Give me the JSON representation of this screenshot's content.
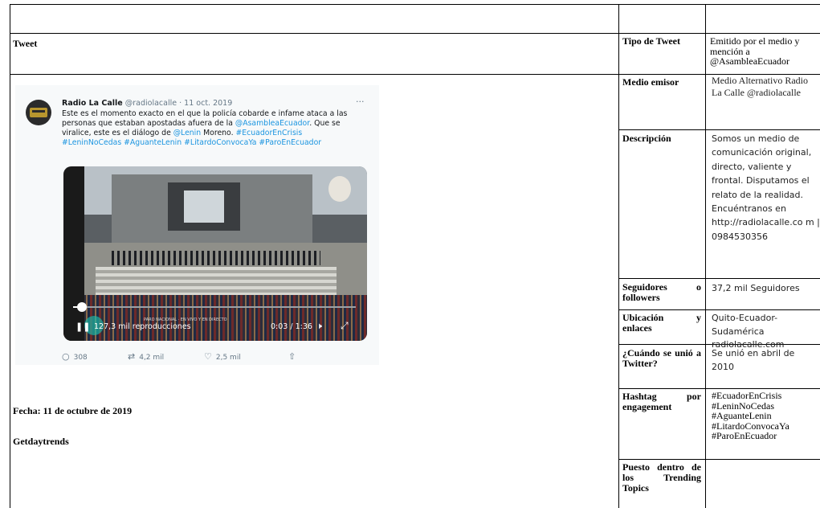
{
  "left_column": {
    "header": "Tweet",
    "fecha": "Fecha: 11 de octubre de 2019",
    "source": "Getdaytrends"
  },
  "tweet": {
    "name": "Radio La Calle",
    "handle": "@radiolacalle",
    "date": "· 11 oct. 2019",
    "more": "···",
    "text_1": "Este es el momento exacto en el que la policía cobarde e infame ataca a las personas que estaban apostadas afuera de la ",
    "mention_1": "@AsambleaEcuador",
    "text_2": ". Que se viralice, este es el diálogo de ",
    "mention_2": "@Lenin",
    "text_3": " Moreno. ",
    "hashtags_line1": "#EcuadorEnCrisis",
    "hashtags_line2": "#LeninNoCedas #AguanteLenin #LitardoConvocaYa #ParoEnEcuador",
    "video": {
      "views": "127,3 mil reproducciones",
      "overlay": "PARO NACIONAL · EN VIVO Y EN DIRECTO",
      "time": "0:03 / 1:36",
      "progress": 0.03
    },
    "actions": {
      "replies": "308",
      "retweets": "4,2 mil",
      "likes": "2,5 mil"
    }
  },
  "rows": [
    {
      "label": "Tipo de Tweet",
      "value": "Emitido por el medio y mención a @AsambleaEcuador"
    },
    {
      "label": "Medio emisor",
      "value": "Medio Alternativo Radio La Calle @radiolacalle"
    },
    {
      "label": "Descripción",
      "value": "Somos un medio de comunicación original, directo, valiente y frontal. Disputamos el relato de la realidad. Encuéntranos en http://radiolacalle.co m | 0984530356"
    },
    {
      "label": "Seguidores o followers",
      "value": "37,2 mil Seguidores"
    },
    {
      "label": "Ubicación y enlaces",
      "value": "Quito-Ecuador-Sudamérica radiolacalle.com"
    },
    {
      "label": "¿Cuándo se unió a Twitter?",
      "value": "Se unió en abril de 2010"
    },
    {
      "label": "Hashtag por engagement",
      "value": "#EcuadorEnCrisis #LeninNoCedas #AguanteLenin #LitardoConvocaYa #ParoEnEcuador"
    },
    {
      "label": "Puesto dentro de los Trending Topics",
      "value": ""
    }
  ]
}
